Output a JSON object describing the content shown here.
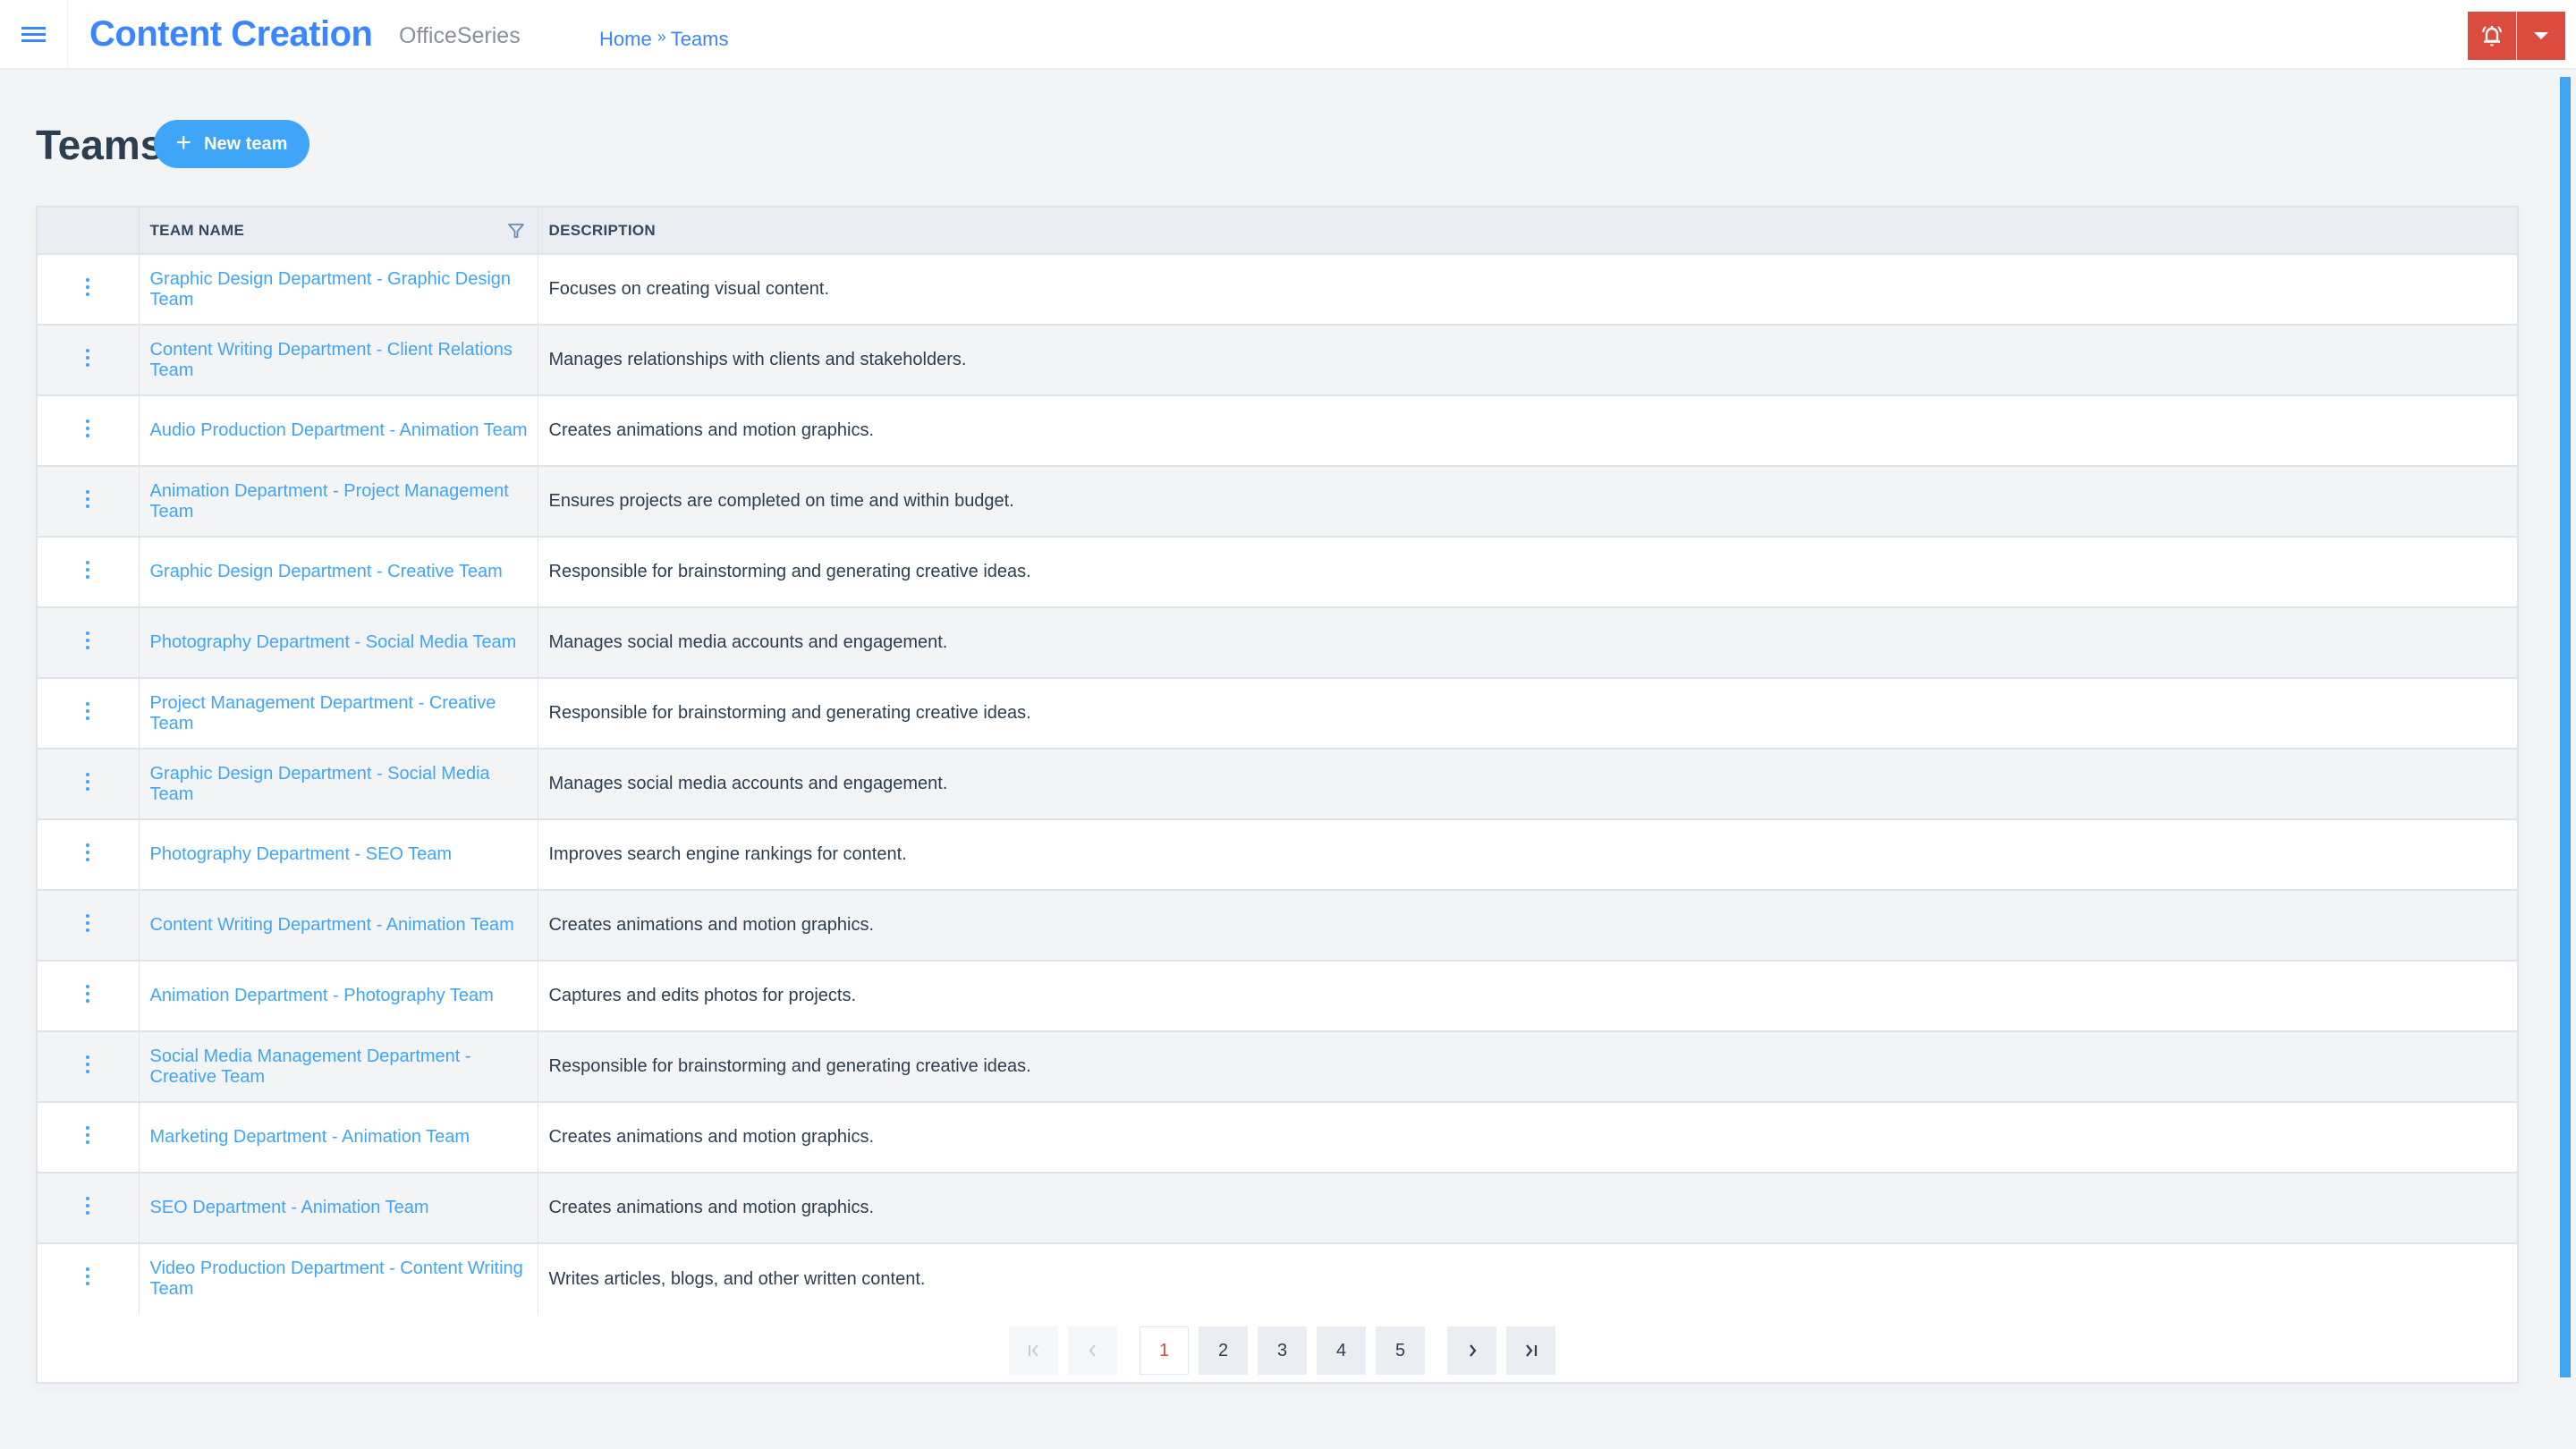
{
  "header": {
    "menu_icon": "hamburger-icon",
    "app_title": "Content Creation",
    "app_subtitle": "OfficeSeries",
    "breadcrumb": [
      {
        "label": "Home"
      },
      {
        "label": "Teams"
      }
    ],
    "breadcrumb_separator": "»",
    "notification_icon": "bell-icon",
    "dropdown_icon": "caret-down-icon",
    "accent_color": "#3a86ff",
    "alert_color": "#db4c3f"
  },
  "page": {
    "title": "Teams",
    "new_button_icon": "+",
    "new_button_label": "New team"
  },
  "table": {
    "columns": [
      {
        "label": ""
      },
      {
        "label": "TEAM NAME",
        "filter_icon": "filter-icon"
      },
      {
        "label": "DESCRIPTION"
      }
    ],
    "rows": [
      {
        "name": "Graphic Design Department - Graphic Design Team",
        "description": "Focuses on creating visual content."
      },
      {
        "name": "Content Writing Department - Client Relations Team",
        "description": "Manages relationships with clients and stakeholders."
      },
      {
        "name": "Audio Production Department - Animation Team",
        "description": "Creates animations and motion graphics."
      },
      {
        "name": "Animation Department - Project Management Team",
        "description": "Ensures projects are completed on time and within budget."
      },
      {
        "name": "Graphic Design Department - Creative Team",
        "description": "Responsible for brainstorming and generating creative ideas."
      },
      {
        "name": "Photography Department - Social Media Team",
        "description": "Manages social media accounts and engagement."
      },
      {
        "name": "Project Management Department - Creative Team",
        "description": "Responsible for brainstorming and generating creative ideas."
      },
      {
        "name": "Graphic Design Department - Social Media Team",
        "description": "Manages social media accounts and engagement."
      },
      {
        "name": "Photography Department - SEO Team",
        "description": "Improves search engine rankings for content."
      },
      {
        "name": "Content Writing Department - Animation Team",
        "description": "Creates animations and motion graphics."
      },
      {
        "name": "Animation Department - Photography Team",
        "description": "Captures and edits photos for projects."
      },
      {
        "name": "Social Media Management Department - Creative Team",
        "description": "Responsible for brainstorming and generating creative ideas."
      },
      {
        "name": "Marketing Department - Animation Team",
        "description": "Creates animations and motion graphics."
      },
      {
        "name": "SEO Department - Animation Team",
        "description": "Creates animations and motion graphics."
      },
      {
        "name": "Video Production Department - Content Writing Team",
        "description": "Writes articles, blogs, and other written content."
      }
    ]
  },
  "pagination": {
    "first_label": "|<",
    "prev_label": "<",
    "pages": [
      "1",
      "2",
      "3",
      "4",
      "5"
    ],
    "current_page": "1",
    "next_label": ">",
    "last_label": ">|"
  }
}
